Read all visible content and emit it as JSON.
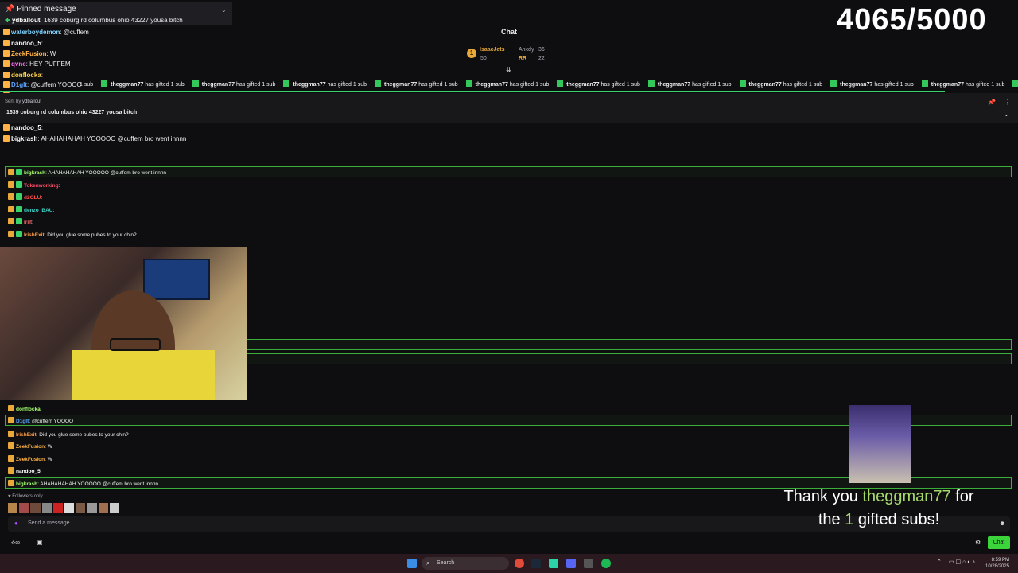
{
  "pinned": {
    "header": "Pinned message",
    "user": "ydballout",
    "text": "1639 coburg rd columbus ohio 43227 yousa bitch"
  },
  "counter": "4065/5000",
  "chat_header": {
    "title": "Chat",
    "rank": "1",
    "first_name": "IsaacJets",
    "first_count": "50",
    "second_name": "Anxdy",
    "second_count": "36",
    "third_name": "RR",
    "third_count": "22"
  },
  "gift_bar": {
    "user": "theggman77",
    "text": "has gifted 1 sub",
    "first_text": "1 sub",
    "repeat": 11
  },
  "top_chat": [
    {
      "user": "waterboydemon",
      "sep": ":",
      "text": "@cuffem",
      "color": "#7fd3ff"
    },
    {
      "user": "nandoo_5",
      "sep": ":",
      "text": "",
      "color": "#ffffff"
    },
    {
      "user": "ZeekFusion",
      "sep": ":",
      "text": "W",
      "color": "#ffb347"
    },
    {
      "user": "qvne",
      "sep": ":",
      "text": "HEY PUFFEM",
      "color": "#ff6ef0"
    },
    {
      "user": "donflocka",
      "sep": ":",
      "text": "",
      "color": "#ffd24a"
    },
    {
      "user": "D1gIt",
      "sep": ":",
      "text": "@cuffem YOOOO",
      "color": "#5aa5ff"
    },
    {
      "user": "IrishExit",
      "sep": ":",
      "text": "Did you glue some pubes to your chin?",
      "color": "#ff9b40"
    },
    {
      "user": "ZeekFusion",
      "sep": ":",
      "text": "W",
      "color": "#ffb347"
    },
    {
      "user": "nandoo_5",
      "sep": ":",
      "text": "",
      "color": "#ffffff"
    },
    {
      "user": "bigkrash",
      "sep": ":",
      "text": "AHAHAHAHAH YOOOOO @cuffem bro went innnn",
      "color": "#ffffff"
    }
  ],
  "pin2": {
    "sent_by": "Sent by",
    "user": "ydballout",
    "text": "1639 coburg rd columbus ohio 43227 yousa bitch"
  },
  "mid_chat": [
    {
      "user": "bigkrash",
      "text": "AHAHAHAHAH YOOOOO @cuffem bro went innnn",
      "color": "#a6ff6c"
    },
    {
      "user": "Tokenworking",
      "text": "",
      "color": "#ff4d6a"
    },
    {
      "user": "d2OLU",
      "text": "",
      "color": "#ff4d4d"
    },
    {
      "user": "denzo_BAU",
      "text": "",
      "color": "#3ad3c9"
    },
    {
      "user": "irilt",
      "text": "",
      "color": "#ff6666"
    },
    {
      "user": "IrishExit",
      "text": "Did you glue some pubes to your chin?",
      "color": "#ff9b40"
    }
  ],
  "bottom_chat": [
    {
      "user": "donflocka",
      "text": "",
      "color": "#a6ff6c"
    },
    {
      "user": "D1gIt",
      "text": "@cuffem YOOOO",
      "color": "#5aa5ff"
    },
    {
      "user": "IrishExit",
      "text": "Did you glue some pubes to your chin?",
      "color": "#ff9b40"
    },
    {
      "user": "ZeekFusion",
      "text": "W",
      "color": "#ffb347"
    },
    {
      "user": "ZeekFusion",
      "text": "W",
      "color": "#ffb347"
    },
    {
      "user": "nandoo_5",
      "text": "",
      "color": "#ffffff"
    },
    {
      "user": "bigkrash",
      "text": "AHAHAHAHAH YOOOOO @cuffem bro went innnn",
      "color": "#a6ff6c"
    }
  ],
  "followers_only": "Followers only",
  "input_placeholder": "Send a message",
  "chat_button": "Chat",
  "alert": {
    "pre": "Thank you ",
    "user": "theggman77",
    "mid": " for",
    "pre2": "the ",
    "count": "1",
    "post": " gifted subs!"
  },
  "taskbar": {
    "search": "Search",
    "time": "8:59 PM",
    "date": "10/28/2025"
  }
}
